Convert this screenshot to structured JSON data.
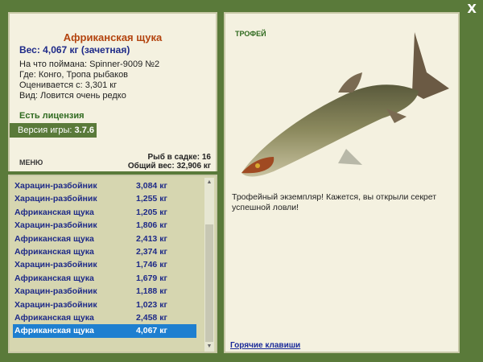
{
  "window": {
    "close_label": "X"
  },
  "catch": {
    "fish_name": "Африканская щука",
    "weight_line": "Вес: 4,067 кг (зачетная)",
    "bait_line": "На что поймана: Spinner-9009 №2",
    "place_line": "Где: Конго, Тропа рыбаков",
    "value_line": "Оценивается с: 3,301 кг",
    "rarity_line": "Вид: Ловится очень редко"
  },
  "license_label": "Есть лицензия",
  "version": {
    "label": "Версия игры:",
    "number": "3.7.6"
  },
  "menu_label": "МЕНЮ",
  "stats": {
    "fish_count": "Рыб в садке: 16",
    "total_weight": "Общий вес: 32,906 кг"
  },
  "catch_list": [
    {
      "name": "Харацин-разбойник",
      "weight": "3,084 кг"
    },
    {
      "name": "Харацин-разбойник",
      "weight": "1,255 кг"
    },
    {
      "name": "Африканская щука",
      "weight": "1,205 кг"
    },
    {
      "name": "Харацин-разбойник",
      "weight": "1,806 кг"
    },
    {
      "name": "Африканская щука",
      "weight": "2,413 кг"
    },
    {
      "name": "Африканская щука",
      "weight": "2,374 кг"
    },
    {
      "name": "Харацин-разбойник",
      "weight": "1,746 кг"
    },
    {
      "name": "Африканская щука",
      "weight": "1,679 кг"
    },
    {
      "name": "Харацин-разбойник",
      "weight": "1,188 кг"
    },
    {
      "name": "Харацин-разбойник",
      "weight": "1,023 кг"
    },
    {
      "name": "Африканская щука",
      "weight": "2,458 кг"
    },
    {
      "name": "Африканская щука",
      "weight": "4,067 кг"
    }
  ],
  "selected_index": 11,
  "trophy": {
    "label": "ТРОФЕЙ",
    "text": "Трофейный экземпляр! Кажется, вы открыли секрет успешной ловли!"
  },
  "hotkeys_label": "Горячие клавиши",
  "colors": {
    "background": "#5a7a3a",
    "panel": "#f4f1e0",
    "selection": "#1e7fd0",
    "title": "#b3440f",
    "list_text": "#1e2a88"
  }
}
